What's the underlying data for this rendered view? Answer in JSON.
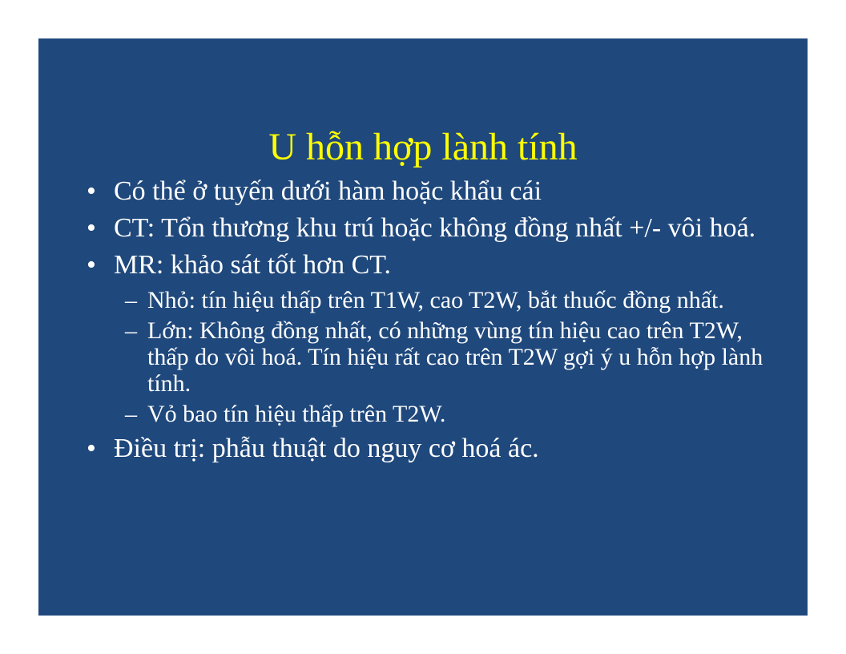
{
  "slide": {
    "title": "U hỗn hợp lành tính",
    "bullet_marker": "•",
    "sub_marker": "–",
    "bullets": [
      {
        "text": "Có thể ở tuyến dưới hàm hoặc khẩu cái"
      },
      {
        "text": "CT: Tổn thương khu trú hoặc không đồng nhất +/- vôi hoá."
      },
      {
        "text": "MR: khảo sát tốt hơn CT."
      },
      {
        "text": "Điều trị: phẫu thuật do nguy cơ hoá ác."
      }
    ],
    "sub_bullets": [
      {
        "text": "Nhỏ: tín hiệu thấp trên T1W, cao T2W, bắt thuốc đồng nhất."
      },
      {
        "text": "Lớn: Không đồng nhất, có những vùng tín hiệu cao trên T2W, thấp do vôi hoá. Tín hiệu rất cao trên T2W gợi ý u hỗn hợp lành tính."
      },
      {
        "text": "Vỏ bao tín hiệu thấp trên T2W."
      }
    ]
  }
}
